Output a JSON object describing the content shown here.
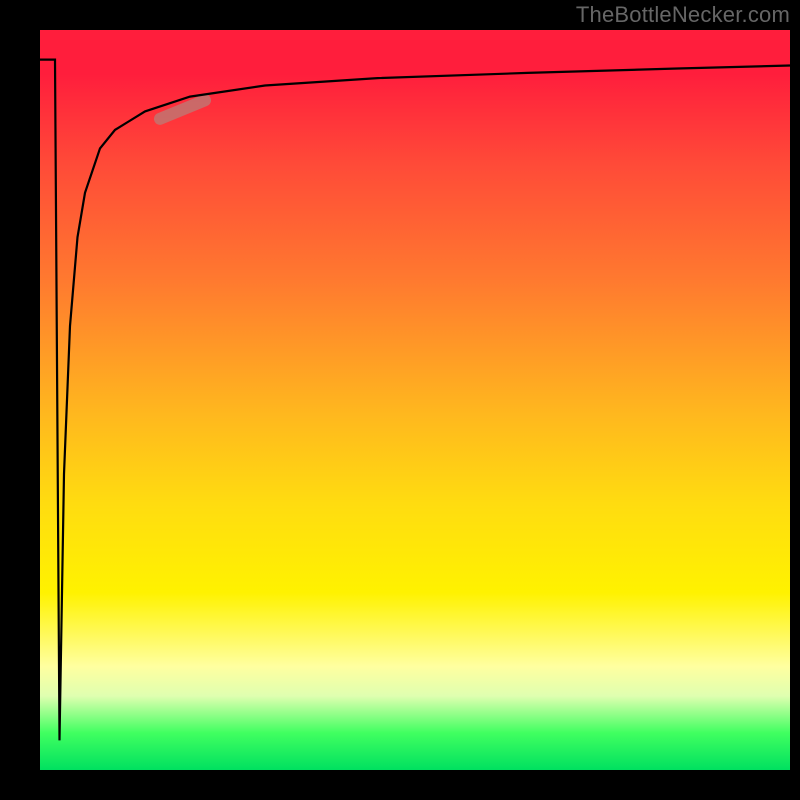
{
  "source_label": "TheBottleNecker.com",
  "chart_data": {
    "type": "line",
    "title": "",
    "xlabel": "",
    "ylabel": "",
    "xlim": [
      0,
      100
    ],
    "ylim": [
      0,
      100
    ],
    "series": [
      {
        "name": "curve",
        "x": [
          0,
          2,
          2.6,
          3.2,
          4,
          5,
          6,
          8,
          10,
          14,
          20,
          30,
          45,
          65,
          85,
          100
        ],
        "y": [
          96,
          96,
          4,
          40,
          60,
          72,
          78,
          84,
          86.5,
          89,
          91,
          92.5,
          93.5,
          94.2,
          94.8,
          95.2
        ]
      }
    ],
    "highlight_segment": {
      "x0": 16,
      "y0": 88,
      "x1": 22,
      "y1": 90.5
    },
    "background_gradient_stops": [
      {
        "pos": 0,
        "color": "#FF1E3C"
      },
      {
        "pos": 6,
        "color": "#FF1E3C"
      },
      {
        "pos": 18,
        "color": "#FF4A38"
      },
      {
        "pos": 34,
        "color": "#FF7A2F"
      },
      {
        "pos": 52,
        "color": "#FFB81E"
      },
      {
        "pos": 64,
        "color": "#FFDC10"
      },
      {
        "pos": 76,
        "color": "#FFF200"
      },
      {
        "pos": 86,
        "color": "#FFFFA0"
      },
      {
        "pos": 90,
        "color": "#DFFFB0"
      },
      {
        "pos": 95,
        "color": "#40FF60"
      },
      {
        "pos": 100,
        "color": "#00E060"
      }
    ]
  }
}
